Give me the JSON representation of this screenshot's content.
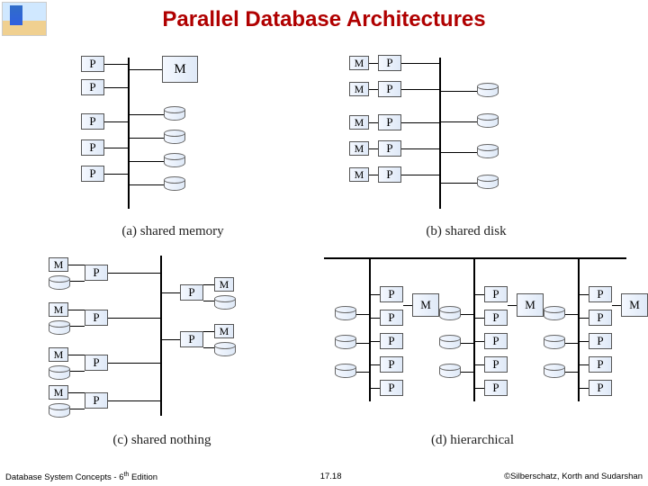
{
  "title": "Parallel Database Architectures",
  "labels": {
    "P": "P",
    "M": "M"
  },
  "captions": {
    "a": "(a) shared memory",
    "b": "(b) shared disk",
    "c": "(c) shared nothing",
    "d": "(d) hierarchical"
  },
  "footer": {
    "left_a": "Database System Concepts - 6",
    "left_sup": "th",
    "left_b": " Edition",
    "center": "17.18",
    "right": "©Silberschatz, Korth and Sudarshan"
  }
}
